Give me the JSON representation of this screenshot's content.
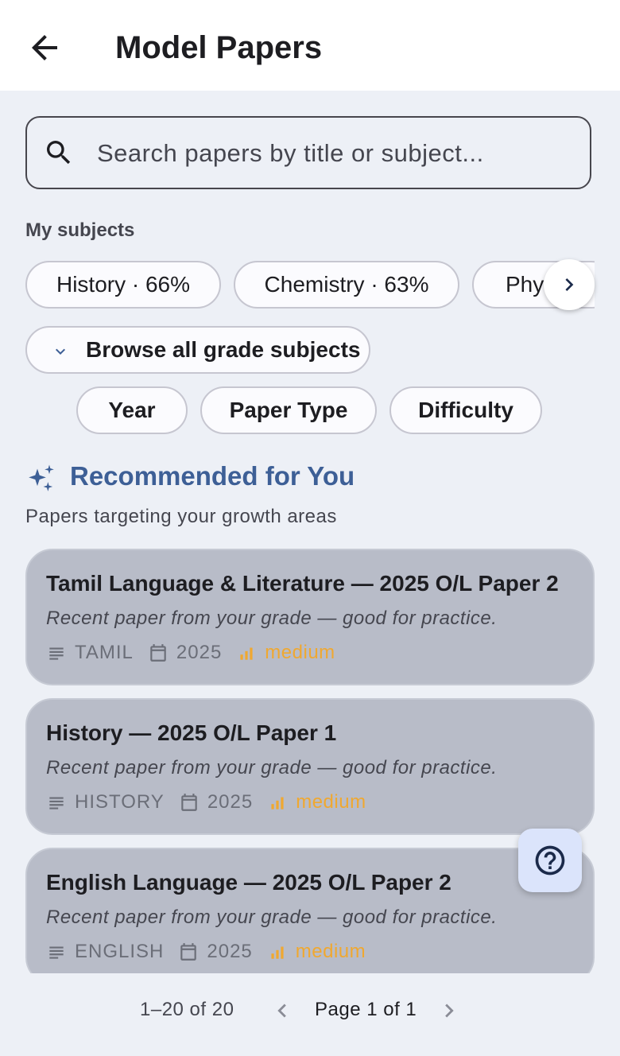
{
  "header": {
    "title": "Model Papers",
    "back_icon": "arrow-back-icon"
  },
  "search": {
    "placeholder": "Search papers by title or subject...",
    "value": "",
    "icon": "search-icon"
  },
  "my_subjects": {
    "label": "My subjects",
    "chips": [
      {
        "label": "History · 66%"
      },
      {
        "label": "Chemistry · 63%"
      },
      {
        "label": "Phys"
      }
    ],
    "scroll_icon": "chevron-right-icon"
  },
  "browse": {
    "label": "Browse all grade subjects",
    "icon": "chevron-down-icon"
  },
  "filters": [
    {
      "label": "Year"
    },
    {
      "label": "Paper Type"
    },
    {
      "label": "Difficulty"
    }
  ],
  "recommended": {
    "title": "Recommended for You",
    "subtitle": "Papers targeting your growth areas",
    "icon": "sparkles-icon",
    "title_color": "#3d5f96"
  },
  "papers": [
    {
      "title": "Tamil Language & Literature — 2025 O/L Paper 2",
      "description": "Recent paper from your grade — good for practice.",
      "subject": "TAMIL",
      "year": "2025",
      "difficulty": "medium"
    },
    {
      "title": "History — 2025 O/L Paper 1",
      "description": "Recent paper from your grade — good for practice.",
      "subject": "HISTORY",
      "year": "2025",
      "difficulty": "medium"
    },
    {
      "title": "English Language — 2025 O/L Paper 2",
      "description": "Recent paper from your grade — good for practice.",
      "subject": "ENGLISH",
      "year": "2025",
      "difficulty": "medium"
    }
  ],
  "colors": {
    "difficulty_medium": "#f0a830",
    "card_background": "#b8bcc8",
    "help_fab": "#dbe4fb"
  },
  "help_icon": "help-circle-icon",
  "pagination": {
    "range": "1–20 of 20",
    "page_label": "Page 1 of 1",
    "prev_icon": "chevron-left-icon",
    "next_icon": "chevron-right-icon"
  }
}
